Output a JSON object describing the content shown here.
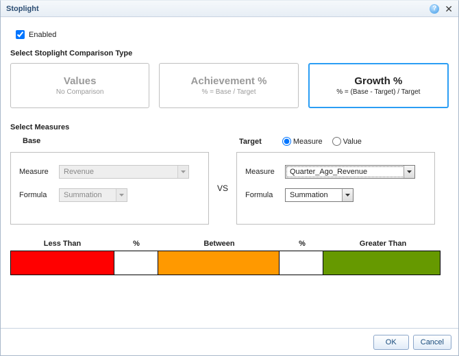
{
  "title": "Stoplight",
  "enabled_label": "Enabled",
  "enabled_checked": true,
  "section_type_heading": "Select Stoplight Comparison Type",
  "types": [
    {
      "title": "Values",
      "subtitle": "No Comparison",
      "selected": false
    },
    {
      "title": "Achievement %",
      "subtitle": "% = Base / Target",
      "selected": false
    },
    {
      "title": "Growth %",
      "subtitle": "% = (Base - Target) / Target",
      "selected": true
    }
  ],
  "section_measures_heading": "Select Measures",
  "base": {
    "title": "Base",
    "measure_label": "Measure",
    "measure_value": "Revenue",
    "formula_label": "Formula",
    "formula_value": "Summation"
  },
  "vs_label": "VS",
  "target": {
    "title": "Target",
    "radio_measure": "Measure",
    "radio_value": "Value",
    "radio_selected": "Measure",
    "measure_label": "Measure",
    "measure_value": "Quarter_Ago_Revenue",
    "formula_label": "Formula",
    "formula_value": "Summation"
  },
  "color_headers": {
    "less_than": "Less Than",
    "pct1": "%",
    "between": "Between",
    "pct2": "%",
    "greater_than": "Greater Than"
  },
  "colors": {
    "red": "#ff0000",
    "orange": "#ff9900",
    "green": "#669900"
  },
  "buttons": {
    "ok": "OK",
    "cancel": "Cancel"
  },
  "help_glyph": "?",
  "close_glyph": "✕"
}
